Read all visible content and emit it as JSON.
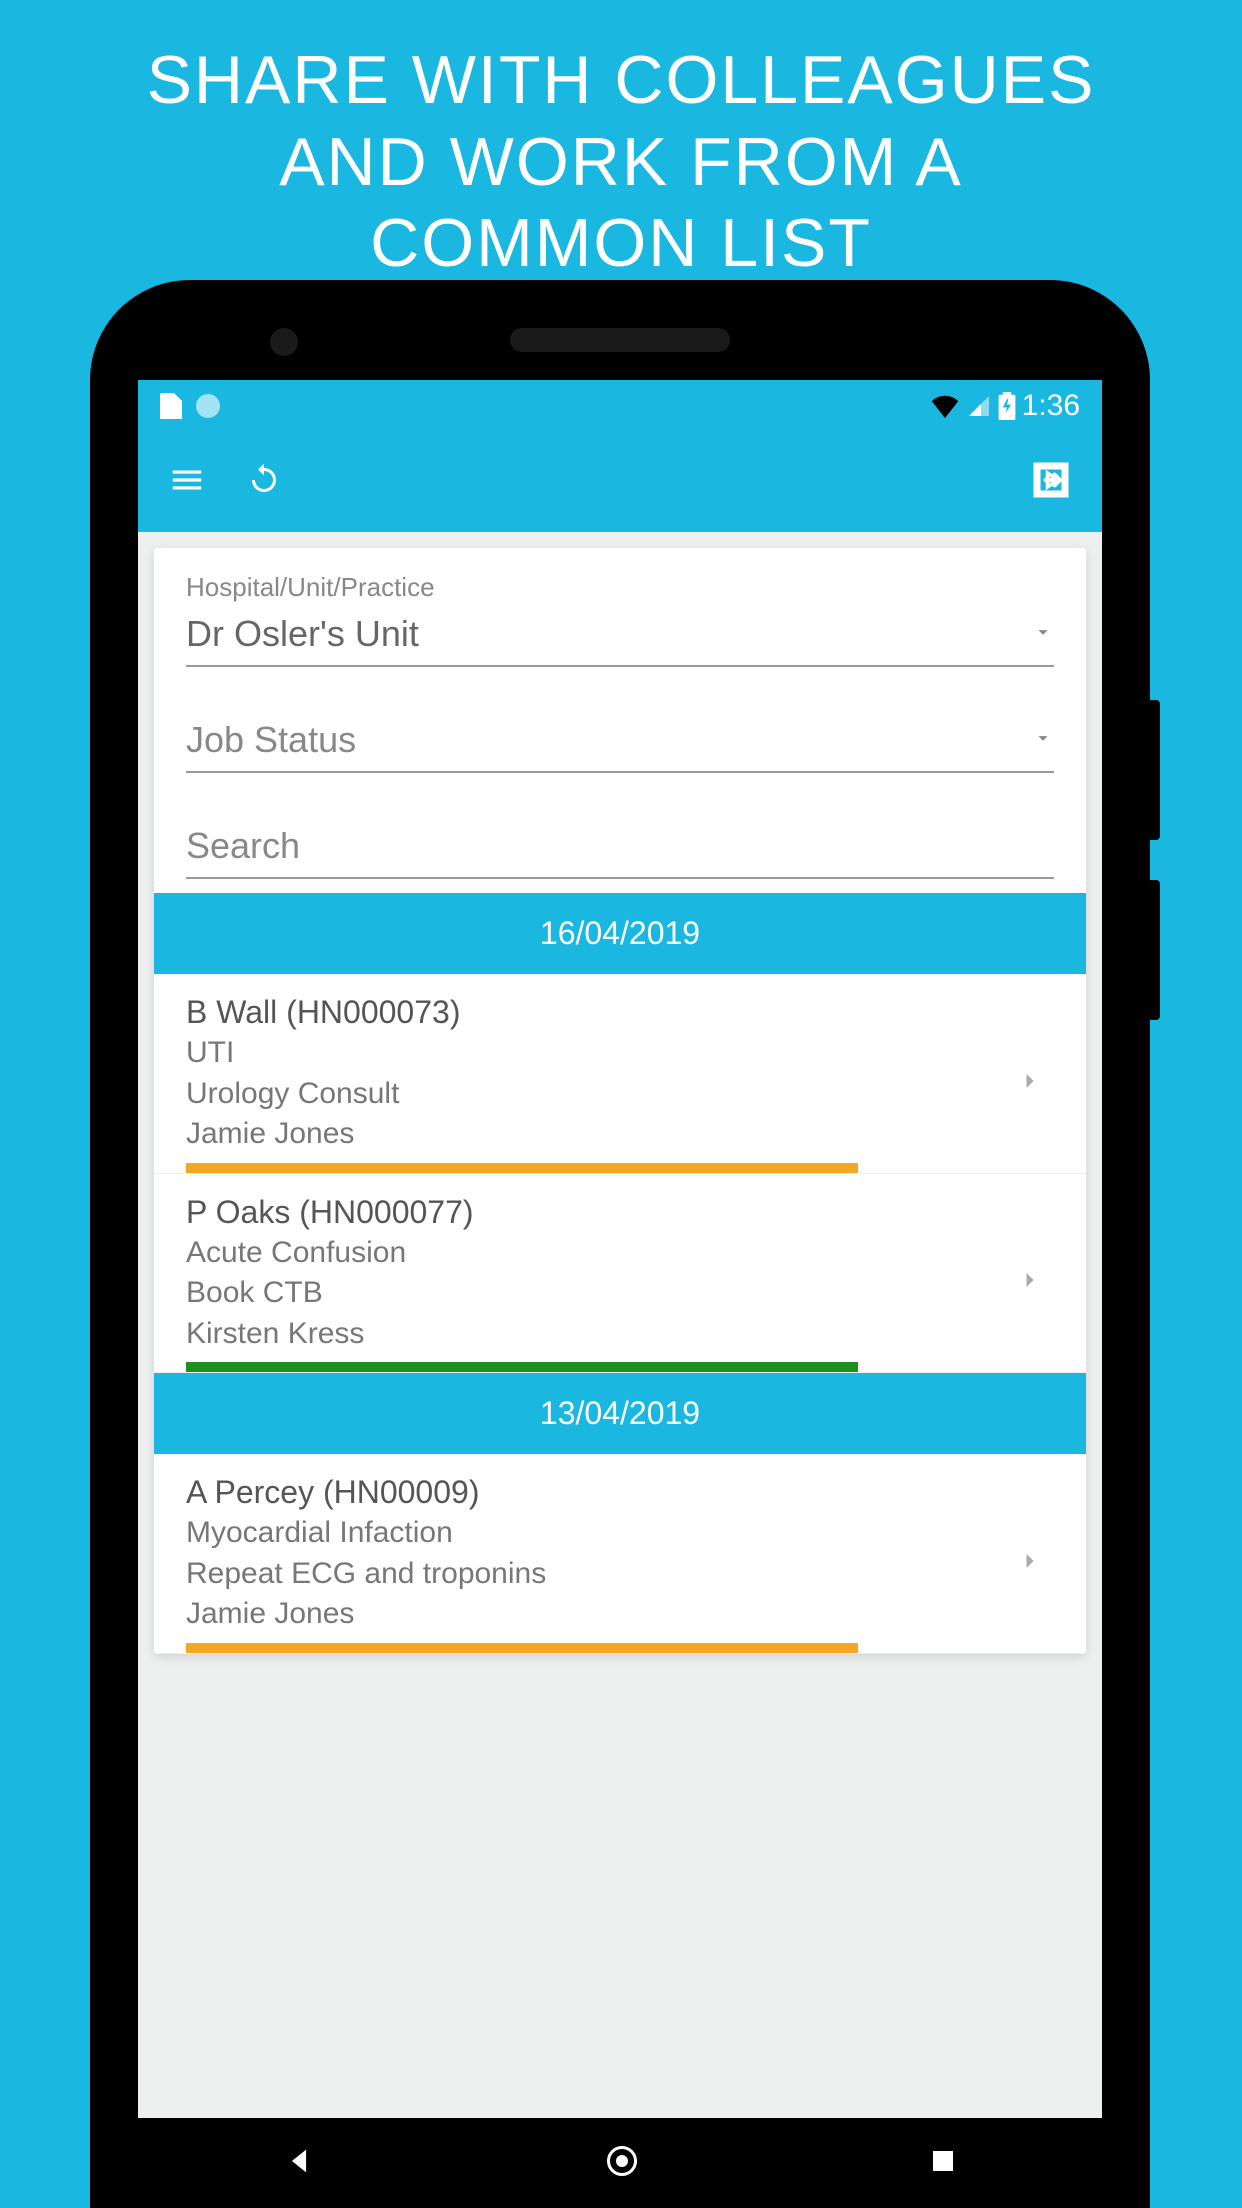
{
  "promo": {
    "line1": "SHARE WITH COLLEAGUES",
    "line2": "AND WORK FROM A",
    "line3": "COMMON LIST"
  },
  "statusBar": {
    "time": "1:36"
  },
  "filters": {
    "unitLabel": "Hospital/Unit/Practice",
    "unitValue": "Dr Osler's Unit",
    "jobStatusPlaceholder": "Job Status",
    "searchPlaceholder": "Search"
  },
  "sections": [
    {
      "date": "16/04/2019",
      "items": [
        {
          "title": "B Wall (HN000073)",
          "diagnosis": "UTI",
          "task": "Urology Consult",
          "assignee": "Jamie Jones",
          "statusColor": "orange"
        },
        {
          "title": "P Oaks (HN000077)",
          "diagnosis": "Acute Confusion",
          "task": "Book CTB",
          "assignee": "Kirsten Kress",
          "statusColor": "green"
        }
      ]
    },
    {
      "date": "13/04/2019",
      "items": [
        {
          "title": "A Percey (HN00009)",
          "diagnosis": "Myocardial Infaction",
          "task": "Repeat ECG and troponins",
          "assignee": "Jamie Jones",
          "statusColor": "orange"
        }
      ]
    }
  ]
}
